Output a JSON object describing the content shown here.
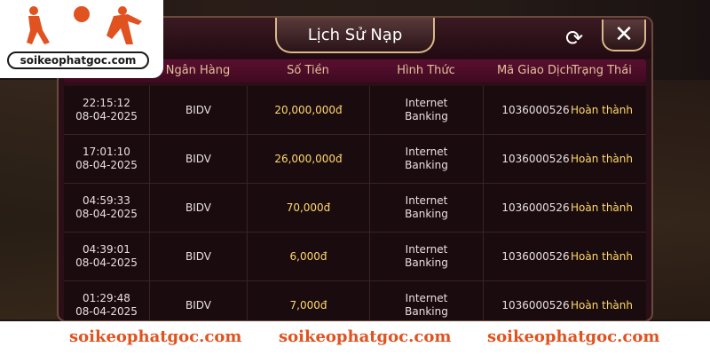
{
  "dialog": {
    "title": "Lịch Sử Nạp"
  },
  "icons": {
    "refresh": "refresh-icon",
    "close": "close-icon"
  },
  "table": {
    "columns": [
      "Ngân Hàng",
      "Số Tiền",
      "Hình Thức",
      "Mã Giao Dịch",
      "Trạng Thái"
    ],
    "rows": [
      {
        "time": "22:15:12",
        "date": "08-04-2025",
        "bank": "BIDV",
        "amount": "20,000,000đ",
        "method_1": "Internet",
        "method_2": "Banking",
        "txn": "1036000526",
        "status": "Hoàn thành"
      },
      {
        "time": "17:01:10",
        "date": "08-04-2025",
        "bank": "BIDV",
        "amount": "26,000,000đ",
        "method_1": "Internet",
        "method_2": "Banking",
        "txn": "1036000526",
        "status": "Hoàn thành"
      },
      {
        "time": "04:59:33",
        "date": "08-04-2025",
        "bank": "BIDV",
        "amount": "70,000đ",
        "method_1": "Internet",
        "method_2": "Banking",
        "txn": "1036000526",
        "status": "Hoàn thành"
      },
      {
        "time": "04:39:01",
        "date": "08-04-2025",
        "bank": "BIDV",
        "amount": "6,000đ",
        "method_1": "Internet",
        "method_2": "Banking",
        "txn": "1036000526",
        "status": "Hoàn thành"
      },
      {
        "time": "01:29:48",
        "date": "08-04-2025",
        "bank": "BIDV",
        "amount": "7,000đ",
        "method_1": "Internet",
        "method_2": "Banking",
        "txn": "1036000526",
        "status": "Hoàn thành"
      }
    ]
  },
  "watermark": {
    "logo_text": "soikeophatgoc.com",
    "footer_1": "soikeophatgoc.com",
    "footer_2": "soikeophatgoc.com",
    "footer_3": "soikeophatgoc.com"
  },
  "colors": {
    "accent_gold": "#ffd96a",
    "header_text": "#e3c09a",
    "footer_orange": "#e0521f"
  }
}
